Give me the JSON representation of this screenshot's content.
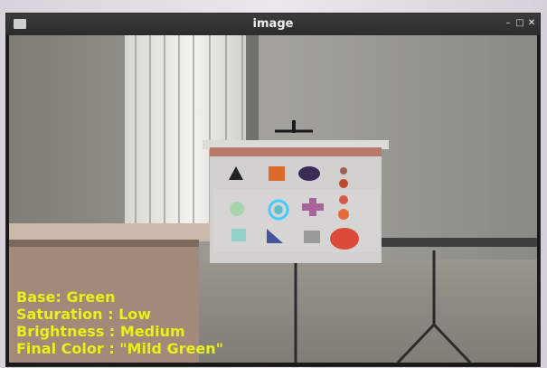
{
  "window": {
    "title": "image"
  },
  "overlay": {
    "base": "Base: Green",
    "saturation": "Saturation : Low",
    "brightness": "Brightness : Medium",
    "final_color": "Final Color : \"Mild Green\""
  },
  "colors": {
    "overlay_text": "#e8ef25",
    "detector_circle": "#27c4ff"
  },
  "icons": [
    "app-window-icon",
    "minimize-icon",
    "maximize-icon",
    "close-icon"
  ]
}
